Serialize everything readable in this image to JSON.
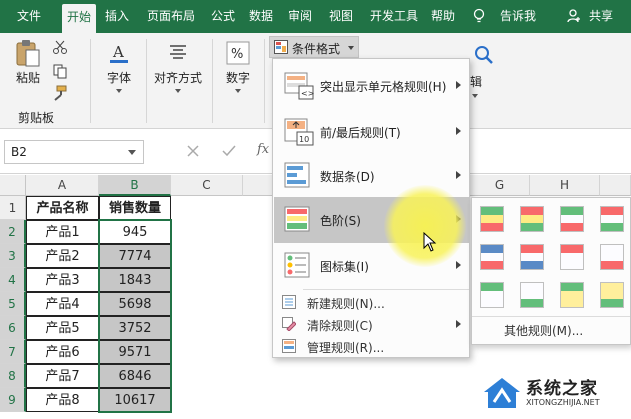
{
  "ribbon_tabs": [
    "文件",
    "开始",
    "插入",
    "页面布局",
    "公式",
    "数据",
    "审阅",
    "视图",
    "开发工具",
    "帮助"
  ],
  "tell_me": "告诉我",
  "share": "共享",
  "clipboard": {
    "paste": "粘贴",
    "group": "剪贴板"
  },
  "groups": {
    "font": "字体",
    "align": "对齐方式",
    "number": "数字",
    "edit_partial": "辑"
  },
  "cond_format": "条件格式",
  "menu": {
    "highlight_rules": "突出显示单元格规则(H)",
    "top_bottom": "前/最后规则(T)",
    "data_bars": "数据条(D)",
    "color_scales": "色阶(S)",
    "icon_sets": "图标集(I)",
    "new_rule": "新建规则(N)...",
    "clear_rules": "清除规则(C)",
    "manage_rules": "管理规则(R)...",
    "more_rules": "其他规则(M)..."
  },
  "name_box": "B2",
  "fx": "fx",
  "columns": [
    "A",
    "B",
    "C",
    "G",
    "H"
  ],
  "rows": [
    "1",
    "2",
    "3",
    "4",
    "5",
    "6",
    "7",
    "8",
    "9"
  ],
  "table": {
    "headers": [
      "产品名称",
      "销售数量"
    ],
    "rows": [
      [
        "产品1",
        "945"
      ],
      [
        "产品2",
        "7774"
      ],
      [
        "产品3",
        "1843"
      ],
      [
        "产品4",
        "5698"
      ],
      [
        "产品5",
        "3752"
      ],
      [
        "产品6",
        "9571"
      ],
      [
        "产品7",
        "6846"
      ],
      [
        "产品8",
        "10617"
      ]
    ]
  },
  "watermark": {
    "title": "系统之家",
    "url": "XITONGZHIJIA.NET"
  },
  "colors": {
    "excel_green": "#217346",
    "hover_gray": "#c6c6c6",
    "highlight_yellow": "#f8f250"
  }
}
